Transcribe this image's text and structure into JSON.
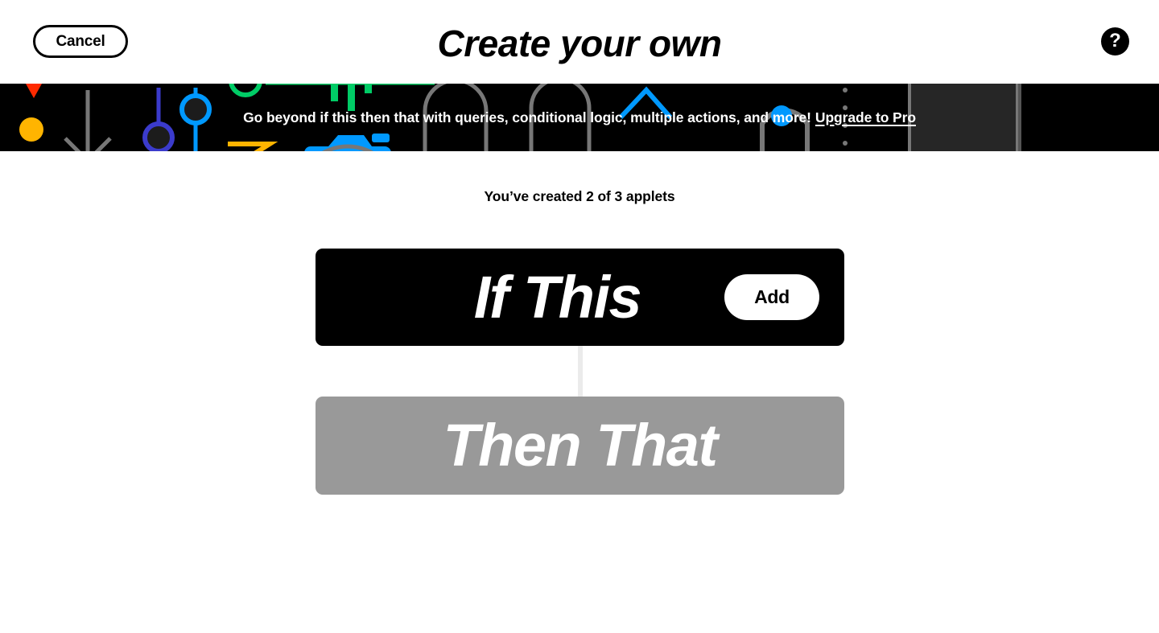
{
  "topbar": {
    "cancel_label": "Cancel",
    "title": "Create your own",
    "help_icon": "question-mark-circle-icon",
    "help_glyph": "?"
  },
  "promo": {
    "message": "Go beyond if this then that with queries, conditional logic, multiple actions, and more!",
    "link_label": "Upgrade to Pro",
    "background_color": "#000000",
    "text_color": "#ffffff"
  },
  "main": {
    "applet_count_text": "You’ve created 2 of 3 applets",
    "if_card": {
      "label": "If This",
      "add_label": "Add",
      "background_color": "#000000",
      "text_color": "#ffffff"
    },
    "then_card": {
      "label": "Then That",
      "background_color": "#999999",
      "text_color": "#ffffff"
    },
    "connector_color": "#ebebeb"
  },
  "palette": {
    "red": "#ff2a00",
    "orange": "#ff6600",
    "yellow": "#ffb400",
    "green": "#00cc66",
    "blue": "#0099ff",
    "indigo": "#3b3bcc",
    "gray": "#666666",
    "panel": "#262626",
    "light_gray": "#ebebeb"
  }
}
